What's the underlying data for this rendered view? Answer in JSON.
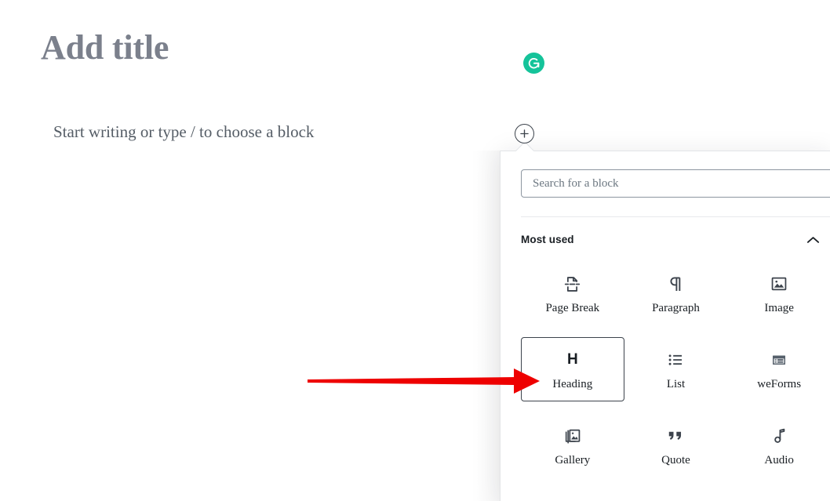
{
  "editor": {
    "title_placeholder": "Add title",
    "block_placeholder": "Start writing or type / to choose a block"
  },
  "badges": {
    "grammarly_label": "G",
    "grammarly_color": "#15c39a"
  },
  "inserter": {
    "toggle_label": "+",
    "search": {
      "placeholder": "Search for a block",
      "value": ""
    },
    "category": {
      "label": "Most used",
      "expanded": true,
      "toggle_icon": "chevron-up-icon"
    },
    "blocks": [
      {
        "label": "Page Break",
        "icon": "page-break-icon",
        "selected": false
      },
      {
        "label": "Paragraph",
        "icon": "paragraph-icon",
        "selected": false
      },
      {
        "label": "Image",
        "icon": "image-icon",
        "selected": false
      },
      {
        "label": "Heading",
        "icon": "heading-icon",
        "selected": true
      },
      {
        "label": "List",
        "icon": "list-icon",
        "selected": false
      },
      {
        "label": "weForms",
        "icon": "weforms-icon",
        "selected": false
      },
      {
        "label": "Gallery",
        "icon": "gallery-icon",
        "selected": false
      },
      {
        "label": "Quote",
        "icon": "quote-icon",
        "selected": false
      },
      {
        "label": "Audio",
        "icon": "audio-icon",
        "selected": false
      }
    ]
  },
  "annotation": {
    "arrow_color": "#ee0000",
    "points_to": "Heading"
  }
}
